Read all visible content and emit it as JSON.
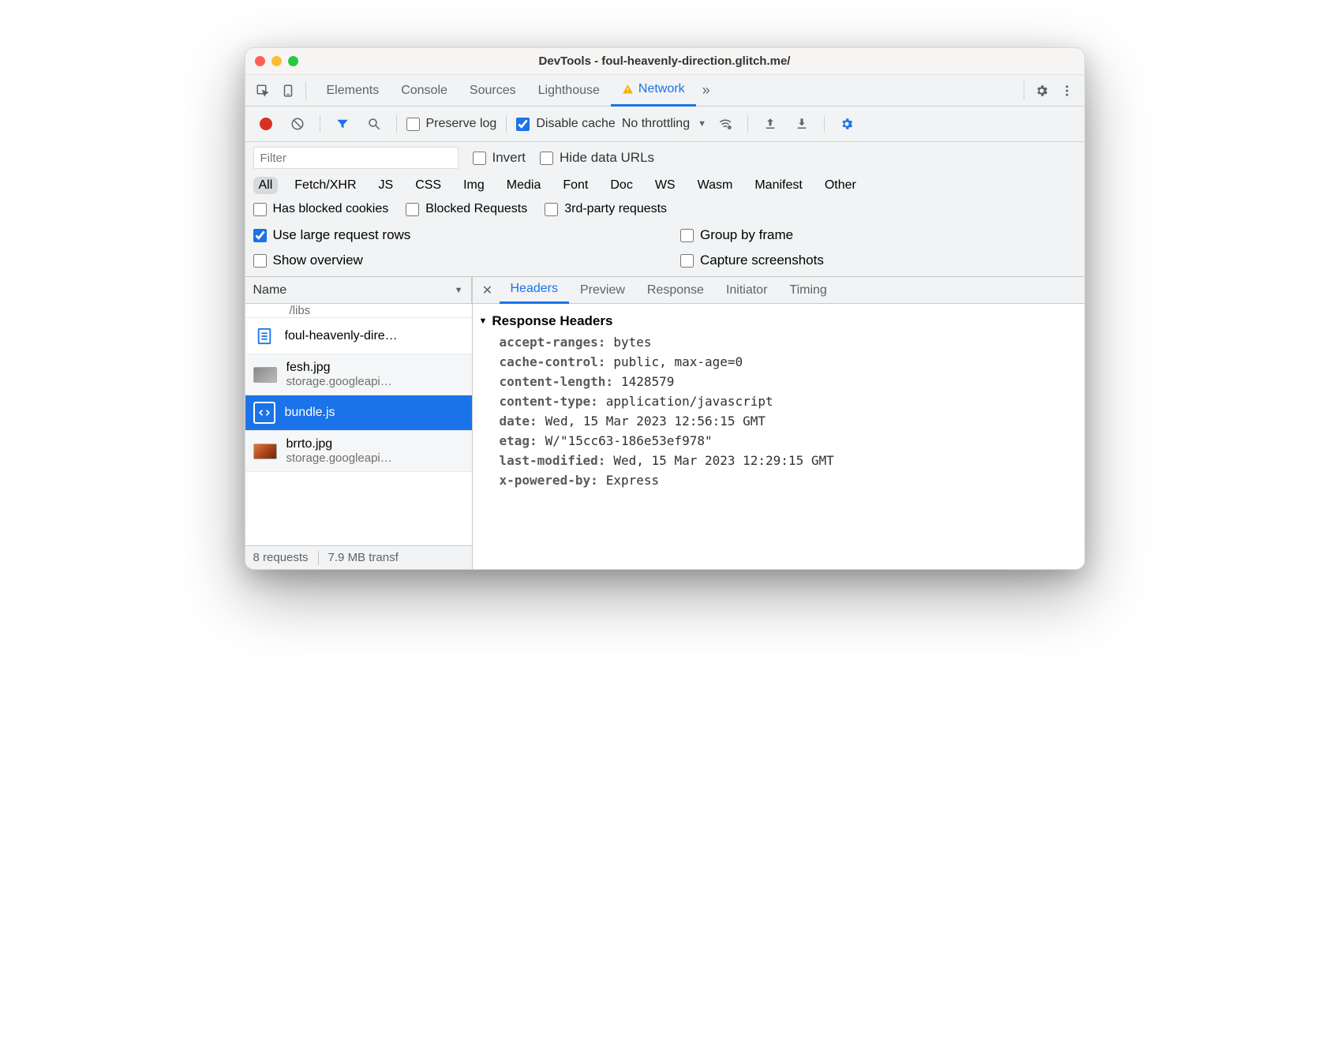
{
  "window": {
    "title": "DevTools - foul-heavenly-direction.glitch.me/"
  },
  "top_tabs": {
    "items": [
      "Elements",
      "Console",
      "Sources",
      "Lighthouse",
      "Network"
    ],
    "active": "Network",
    "more": "»"
  },
  "toolbar": {
    "preserve_log": "Preserve log",
    "disable_cache": "Disable cache",
    "throttling": "No throttling"
  },
  "filter": {
    "placeholder": "Filter",
    "invert": "Invert",
    "hide_data_urls": "Hide data URLs",
    "types": [
      "All",
      "Fetch/XHR",
      "JS",
      "CSS",
      "Img",
      "Media",
      "Font",
      "Doc",
      "WS",
      "Wasm",
      "Manifest",
      "Other"
    ],
    "active_type": "All",
    "has_blocked_cookies": "Has blocked cookies",
    "blocked_requests": "Blocked Requests",
    "third_party": "3rd-party requests"
  },
  "options": {
    "use_large_rows": "Use large request rows",
    "group_by_frame": "Group by frame",
    "show_overview": "Show overview",
    "capture_screenshots": "Capture screenshots"
  },
  "requests": {
    "column": "Name",
    "partial_top": "/libs",
    "items": [
      {
        "name": "foul-heavenly-dire…",
        "sub": "",
        "kind": "doc"
      },
      {
        "name": "fesh.jpg",
        "sub": "storage.googleapi…",
        "kind": "img"
      },
      {
        "name": "bundle.js",
        "sub": "",
        "kind": "js",
        "selected": true
      },
      {
        "name": "brrto.jpg",
        "sub": "storage.googleapi…",
        "kind": "img_food"
      }
    ]
  },
  "status": {
    "requests": "8 requests",
    "transfer": "7.9 MB transf"
  },
  "detail": {
    "tabs": [
      "Headers",
      "Preview",
      "Response",
      "Initiator",
      "Timing"
    ],
    "active": "Headers",
    "section": "Response Headers",
    "headers": [
      {
        "k": "accept-ranges",
        "v": "bytes"
      },
      {
        "k": "cache-control",
        "v": "public, max-age=0"
      },
      {
        "k": "content-length",
        "v": "1428579"
      },
      {
        "k": "content-type",
        "v": "application/javascript"
      },
      {
        "k": "date",
        "v": "Wed, 15 Mar 2023 12:56:15 GMT"
      },
      {
        "k": "etag",
        "v": "W/\"15cc63-186e53ef978\""
      },
      {
        "k": "last-modified",
        "v": "Wed, 15 Mar 2023 12:29:15 GMT"
      },
      {
        "k": "x-powered-by",
        "v": "Express"
      }
    ]
  }
}
